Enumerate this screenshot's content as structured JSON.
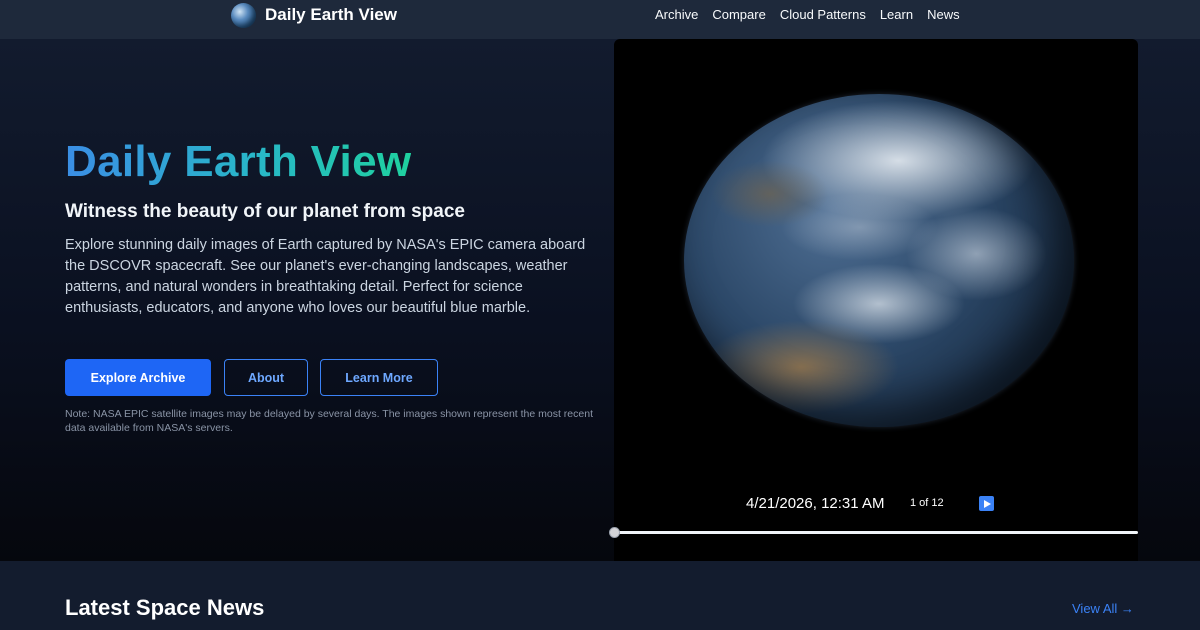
{
  "nav": {
    "brand": "Daily Earth View",
    "links": [
      "Archive",
      "Compare",
      "Cloud Patterns",
      "Learn",
      "News"
    ]
  },
  "hero": {
    "title": "Daily Earth View",
    "subtitle": "Witness the beauty of our planet from space",
    "description": "Explore stunning daily images of Earth captured by NASA's EPIC camera aboard the DSCOVR spacecraft. See our planet's ever-changing landscapes, weather patterns, and natural wonders in breathtaking detail. Perfect for science enthusiasts, educators, and anyone who loves our beautiful blue marble.",
    "buttons": {
      "explore": "Explore Archive",
      "about": "About",
      "learn": "Learn More"
    },
    "note": "Note: NASA EPIC satellite images may be delayed by several days. The images shown represent the most recent data available from NASA's servers."
  },
  "viewer": {
    "timestamp": "4/21/2026, 12:31 AM",
    "counter": "1 of 12",
    "current_index": 1,
    "total_images": 12
  },
  "news": {
    "title": "Latest Space News",
    "view_all": "View All →"
  },
  "colors": {
    "accent": "#1e66f5",
    "title_gradient_start": "#3b8ee5",
    "title_gradient_end": "#1fd19f",
    "nav_bg": "#1e293b"
  }
}
